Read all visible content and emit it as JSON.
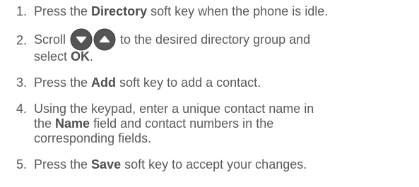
{
  "steps": [
    {
      "number": "1.",
      "before": "Press the ",
      "bold": "Directory",
      "after": " soft key when the phone is idle."
    },
    {
      "number": "2.",
      "before": "Scroll",
      "middle": " to the desired directory group and",
      "line2_before": "select ",
      "bold": "OK",
      "after": ".",
      "icons": [
        "down-arrow-icon",
        "up-arrow-icon"
      ]
    },
    {
      "number": "3.",
      "before": "Press the ",
      "bold": "Add",
      "after": " soft key to add a contact."
    },
    {
      "number": "4.",
      "line1": "Using the keypad, enter a unique contact name in",
      "line2_before": "the ",
      "bold": "Name",
      "line2_after": " field and contact numbers in the",
      "line3": "corresponding fields."
    },
    {
      "number": "5.",
      "before": "Press the ",
      "bold": "Save",
      "after": " soft key to accept your changes."
    }
  ],
  "colors": {
    "text": "#58595b",
    "button_fill": "#555555",
    "button_glyph": "#ffffff"
  }
}
